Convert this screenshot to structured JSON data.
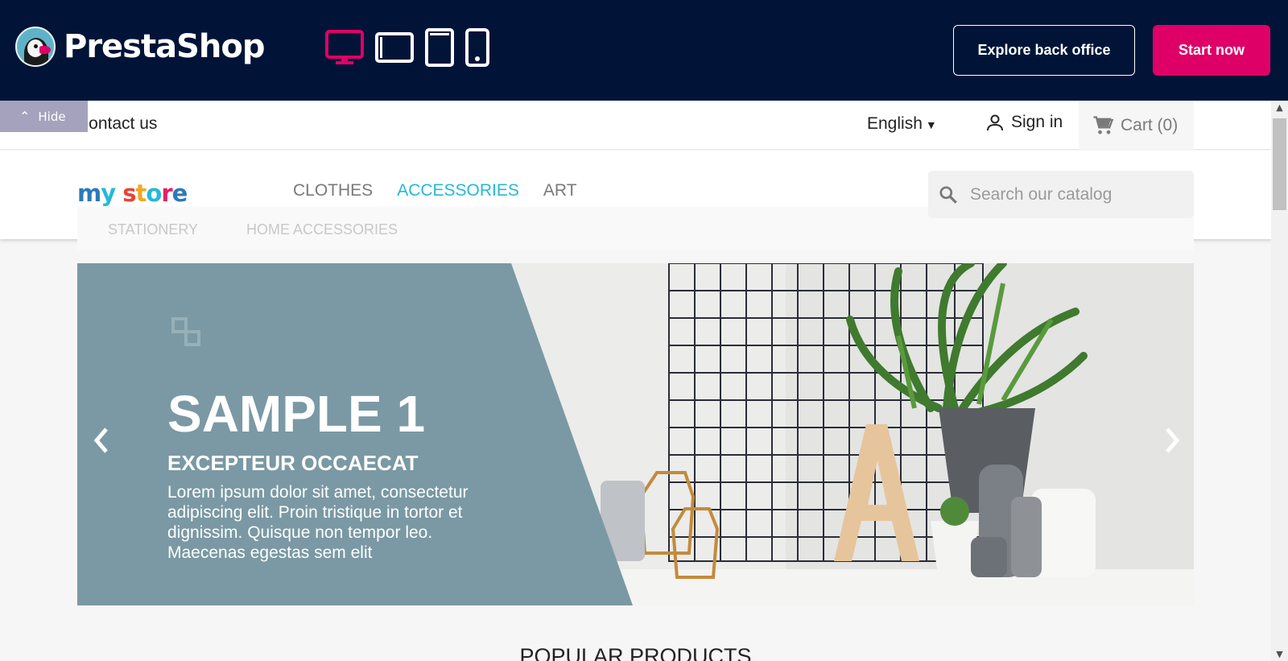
{
  "demo_bar": {
    "logo_text": "PrestaShop",
    "devices": [
      "desktop-icon",
      "tablet-landscape-icon",
      "tablet-portrait-icon",
      "mobile-icon"
    ],
    "explore_label": "Explore back office",
    "start_label": "Start now",
    "accent_color": "#df0067",
    "background_color": "#011437"
  },
  "store": {
    "hide_label": "Hide",
    "contact_label": "Contact us",
    "language": "English",
    "signin_label": "Sign in",
    "cart_label": "Cart",
    "cart_count": "(0)",
    "logo_text": "my store",
    "menu": [
      "CLOTHES",
      "ACCESSORIES",
      "ART"
    ],
    "active_menu": "ACCESSORIES",
    "submenu": [
      "STATIONERY",
      "HOME ACCESSORIES"
    ],
    "search_placeholder": "Search our catalog",
    "slide": {
      "title": "SAMPLE 1",
      "subtitle": "EXCEPTEUR OCCAECAT",
      "description": "Lorem ipsum dolor sit amet, consectetur adipiscing elit. Proin tristique in tortor et dignissim. Quisque non tempor leo. Maecenas egestas sem elit",
      "panel_color": "#7a99a4"
    },
    "section_title": "POPULAR PRODUCTS",
    "link_color": "#25b9d7"
  }
}
